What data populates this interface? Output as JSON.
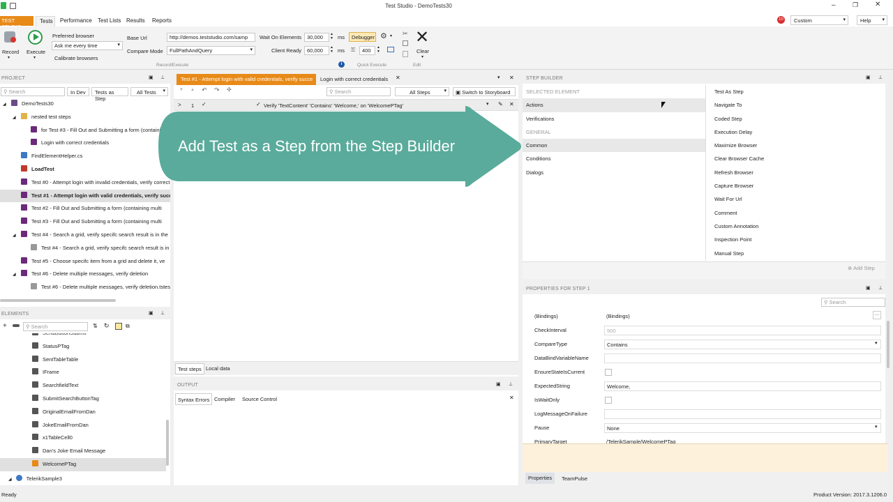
{
  "window": {
    "title": "Test Studio - DemoTests30",
    "ready": "Ready",
    "version": "Product Version: 2017.3.1206.0"
  },
  "menu": {
    "brand": "TEST STUDIO",
    "tabs": [
      "Tests",
      "Performance",
      "Test Lists",
      "Results",
      "Reports"
    ],
    "notif_count": "10",
    "layout": "Custom",
    "help": "Help"
  },
  "ribbon": {
    "record": "Record",
    "execute": "Execute",
    "preferred_browser": "Preferred browser",
    "browser_value": "Ask me every time",
    "calibrate": "Calibrate browsers",
    "base_url_label": "Base Url",
    "base_url": "http://demos.teststudio.com/samp",
    "compare_mode_label": "Compare Mode",
    "compare_mode": "FullPathAndQuery",
    "wait_label": "Wait On Elements",
    "wait_value": "30,000",
    "client_label": "Client Ready",
    "client_value": "60,000",
    "ms": "ms",
    "debugger": "Debugger",
    "slider_value": "400",
    "clear": "Clear",
    "group_record": "Record/Execute",
    "group_quick": "Quick Execute",
    "group_edit": "Edit"
  },
  "project": {
    "title": "PROJECT",
    "search": "Search",
    "in_dev": "In Dev",
    "tests_as_step": "Tests as Step",
    "all_tests": "All Tests",
    "items": [
      {
        "label": "DemoTests30",
        "indent": 0,
        "icon": "#6b4a8a",
        "bold": false,
        "sel": false,
        "arrow": "◢"
      },
      {
        "label": "nested test steps",
        "indent": 1,
        "icon": "#e0b24a",
        "bold": false,
        "sel": false,
        "arrow": "◢"
      },
      {
        "label": "for Test #3 - Fill Out and Submitting a form (containing multi",
        "indent": 2,
        "icon": "#6b2a7a",
        "bold": false,
        "sel": false,
        "arrow": ""
      },
      {
        "label": "Login with correct credentials",
        "indent": 2,
        "icon": "#6b2a7a",
        "bold": false,
        "sel": false,
        "arrow": ""
      },
      {
        "label": "FindElementHelper.cs",
        "indent": 1,
        "icon": "#3c78c4",
        "bold": false,
        "sel": false,
        "arrow": ""
      },
      {
        "label": "LoadTest",
        "indent": 1,
        "icon": "#c0392b",
        "bold": true,
        "sel": false,
        "arrow": ""
      },
      {
        "label": "Test #0 - Attempt login with invalid credentials, verify correct",
        "indent": 1,
        "icon": "#6b2a7a",
        "bold": false,
        "sel": false,
        "arrow": ""
      },
      {
        "label": "Test #1 - Attempt login with valid credentials, verify succ",
        "indent": 1,
        "icon": "#6b2a7a",
        "bold": true,
        "sel": true,
        "arrow": ""
      },
      {
        "label": "Test #2 - Fill Out and Submitting a form (containing multi",
        "indent": 1,
        "icon": "#6b2a7a",
        "bold": false,
        "sel": false,
        "arrow": ""
      },
      {
        "label": "Test #3 - Fill Out and Submitting a form (containing multi",
        "indent": 1,
        "icon": "#6b2a7a",
        "bold": false,
        "sel": false,
        "arrow": ""
      },
      {
        "label": "Test #4 - Search a grid, verify specifc search result is in the",
        "indent": 1,
        "icon": "#6b2a7a",
        "bold": false,
        "sel": false,
        "arrow": "◢"
      },
      {
        "label": "Test #4 - Search a grid, verify specifc search result is in",
        "indent": 2,
        "icon": "#999999",
        "bold": false,
        "sel": false,
        "arrow": ""
      },
      {
        "label": "Test #5 - Choose specifc item from a grid and delete it, ve",
        "indent": 1,
        "icon": "#6b2a7a",
        "bold": false,
        "sel": false,
        "arrow": ""
      },
      {
        "label": "Test #6 - Delete multiple messages, verify deletion",
        "indent": 1,
        "icon": "#6b2a7a",
        "bold": false,
        "sel": false,
        "arrow": "◢"
      },
      {
        "label": "Test #6 - Delete multiple messages, verify deletion.tstest",
        "indent": 2,
        "icon": "#999999",
        "bold": false,
        "sel": false,
        "arrow": ""
      }
    ]
  },
  "elements": {
    "title": "ELEMENTS",
    "search": "Search",
    "items": [
      "SendButtonSubmit",
      "StatusPTag",
      "SentTableTable",
      "IFrame",
      "SearchfieldText",
      "SubmitSearchButtonTag",
      "OriginalEmailFromDan",
      "JokeEmailFromDan",
      "x1TableCell0",
      "Dan's Joke Email Message",
      "WelcomePTag"
    ],
    "root": "TelerikSample3"
  },
  "editor": {
    "tab_active": "Test #1 - Attempt login with valid credentials, verify succe",
    "tab2": "Login with correct credentials",
    "search": "Search",
    "all_steps": "All Steps",
    "storyboard": "Switch to Storyboard",
    "step_num": "1",
    "step_text": "Verify 'TextContent' 'Contains' 'Welcome,' on 'WelcomePTag'",
    "bottom_tabs": [
      "Test steps",
      "Local data"
    ]
  },
  "callout": {
    "text": "Add Test as a Step from the Step Builder",
    "color": "#5aab9b"
  },
  "output": {
    "title": "OUTPUT",
    "tabs": [
      "Syntax Errors",
      "Compiler",
      "Source Control"
    ]
  },
  "step_builder": {
    "title": "STEP BUILDER",
    "left": [
      {
        "label": "SELECTED ELEMENT",
        "header": true,
        "sel": false
      },
      {
        "label": "Actions",
        "header": false,
        "sel": true
      },
      {
        "label": "Verifications",
        "header": false,
        "sel": false
      },
      {
        "label": "GENERAL",
        "header": true,
        "sel": false
      },
      {
        "label": "Common",
        "header": false,
        "sel": true
      },
      {
        "label": "Conditions",
        "header": false,
        "sel": false
      },
      {
        "label": "Dialogs",
        "header": false,
        "sel": false
      }
    ],
    "right": [
      "Test As Step",
      "Navigate To",
      "Coded Step",
      "Execution Delay",
      "Maximize Browser",
      "Clear Browser Cache",
      "Refresh Browser",
      "Capture Browser",
      "Wait For Url",
      "Comment",
      "Custom Annotation",
      "Inspection Point",
      "Manual Step"
    ],
    "add_step": "Add Step"
  },
  "properties": {
    "title": "PROPERTIES FOR STEP 1",
    "search": "Search",
    "rows": [
      {
        "name": "(Bindings)",
        "value": "(Bindings)",
        "kind": "plain"
      },
      {
        "name": "CheckInterval",
        "value": "500",
        "kind": "gray"
      },
      {
        "name": "CompareType",
        "value": "Contains",
        "kind": "select"
      },
      {
        "name": "DataBindVariableName",
        "value": "",
        "kind": "box"
      },
      {
        "name": "EnsureStateIsCurrent",
        "value": "",
        "kind": "check"
      },
      {
        "name": "ExpectedString",
        "value": "Welcome,",
        "kind": "box"
      },
      {
        "name": "IsWaitOnly",
        "value": "",
        "kind": "check"
      },
      {
        "name": "LogMessageOnFailure",
        "value": "",
        "kind": "box"
      },
      {
        "name": "Pause",
        "value": "None",
        "kind": "select"
      },
      {
        "name": "PrimaryTarget",
        "value": "/TelerikSample/WelcomePTag",
        "kind": "plain"
      }
    ],
    "bottom_tabs": [
      "Properties",
      "TeamPulse"
    ]
  }
}
